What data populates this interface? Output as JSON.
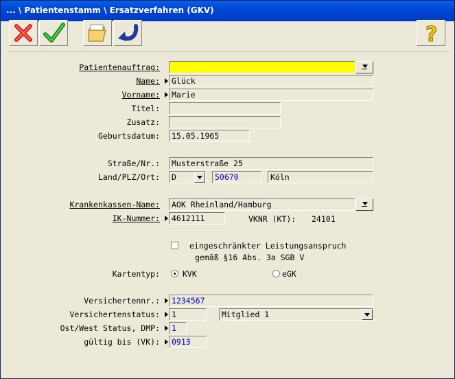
{
  "window": {
    "title": "... \\ Patientenstamm \\ Ersatzverfahren (GKV)"
  },
  "toolbar": {
    "icons": [
      "cancel-icon",
      "confirm-icon",
      "folder-icon",
      "undo-icon",
      "help-icon"
    ]
  },
  "labels": {
    "patientenauftrag": "Patientenauftrag:",
    "name": "Name:",
    "vorname": "Vorname:",
    "titel": "Titel:",
    "zusatz": "Zusatz:",
    "geburtsdatum": "Geburtsdatum:",
    "strasse": "Straße/Nr.:",
    "land": "Land/PLZ/Ort:",
    "krankenkasse": "Krankenkassen-Name:",
    "ik": "IK-Nummer:",
    "kartentyp": "Kartentyp:",
    "versichertennr": "Versichertennr.:",
    "versichertenstatus": "Versichertenstatus:",
    "ostwest": "Ost/West Status, DMP:",
    "gueltig": "gültig bis (VK):"
  },
  "values": {
    "patientenauftrag": "",
    "name": "Glück",
    "vorname": "Marie",
    "titel": "",
    "zusatz": "",
    "geburtsdatum": "15.05.1965",
    "strasse": "Musterstraße 25",
    "land": "D",
    "plz": "50670",
    "ort": "Köln",
    "krankenkasse": "AOK Rheinland/Hamburg",
    "ik": "4612111",
    "vknr_label": "VKNR (KT):",
    "vknr": "24101",
    "versichertennr": "1234567",
    "status_code": "1",
    "status_text": "Mitglied 1",
    "ostwest": "1",
    "gueltig": "0913"
  },
  "checkbox": {
    "line1": "eingeschränkter Leistungsanspruch",
    "line2": "gemäß §16 Abs. 3a SGB V",
    "checked": false
  },
  "kartentyp": {
    "kvk": "KVK",
    "egk": "eGK",
    "selected": "KVK"
  }
}
